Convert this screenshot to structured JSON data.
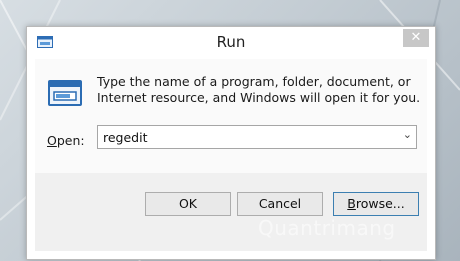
{
  "window": {
    "title": "Run",
    "close_glyph": "✕"
  },
  "dialog": {
    "description": "Type the name of a program, folder, document, or Internet resource, and Windows will open it for you.",
    "open_label_accel": "O",
    "open_label_rest": "pen:",
    "open_value": "regedit",
    "dropdown_glyph": "⌄"
  },
  "buttons": {
    "ok": "OK",
    "cancel": "Cancel",
    "browse_accel": "B",
    "browse_rest": "rowse..."
  },
  "watermark": {
    "text": "Quantrimang"
  },
  "icons": {
    "title": "run-app-icon",
    "dialog": "run-app-icon",
    "close": "close-icon",
    "dropdown": "chevron-down-icon"
  },
  "colors": {
    "window_bg": "#ffffff",
    "footer_bg": "#f0f0f0",
    "close_button_bg": "#c7c7c7",
    "focused_button_border": "#3c7fb1"
  }
}
